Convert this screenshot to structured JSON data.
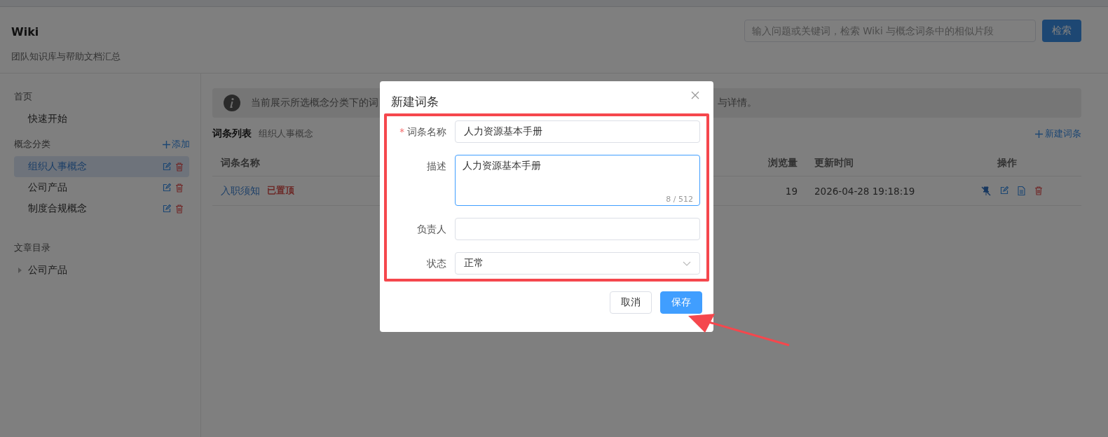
{
  "header": {
    "title": "Wiki",
    "subtitle": "团队知识库与帮助文档汇总",
    "search_placeholder": "输入问题或关键词，检索 Wiki 与概念词条中的相似片段",
    "search_button": "检索"
  },
  "sidebar": {
    "sections": [
      {
        "kind": "plain",
        "title": "首页",
        "items": [
          {
            "label": "快速开始",
            "selected": false
          }
        ]
      },
      {
        "kind": "category",
        "title": "概念分类",
        "action": "添加",
        "items": [
          {
            "label": "组织人事概念",
            "selected": true
          },
          {
            "label": "公司产品",
            "selected": false
          },
          {
            "label": "制度合规概念",
            "selected": false
          }
        ]
      },
      {
        "kind": "tree",
        "title": "文章目录",
        "items": [
          {
            "label": "公司产品",
            "expanded": false
          }
        ]
      }
    ]
  },
  "content": {
    "banner": [
      "当前展示所选概念分类下的词",
      "与详情。"
    ],
    "list_title": "词条列表",
    "list_subtitle": "组织人事概念",
    "new_button": "新建词条",
    "columns": [
      "词条名称",
      "浏览量",
      "更新时间",
      "操作"
    ],
    "rows": [
      {
        "name": "入职须知",
        "pinned": true,
        "pinned_tag": "已置顶",
        "views": "19",
        "updated": "2026-04-28 19:18:19"
      }
    ]
  },
  "dialog": {
    "title": "新建词条",
    "fields": [
      {
        "kind": "input",
        "label": "词条名称",
        "required": true,
        "value": "人力资源基本手册",
        "focused": false
      },
      {
        "kind": "textarea",
        "label": "描述",
        "required": false,
        "value": "人力资源基本手册",
        "counter": "8 / 512",
        "focused": true
      },
      {
        "kind": "input",
        "label": "负责人",
        "required": false,
        "focused": false
      },
      {
        "kind": "select",
        "label": "状态",
        "required": false,
        "value": "正常",
        "focused": false
      }
    ],
    "required_marker": "*",
    "cancel": "取消",
    "save": "保存"
  }
}
